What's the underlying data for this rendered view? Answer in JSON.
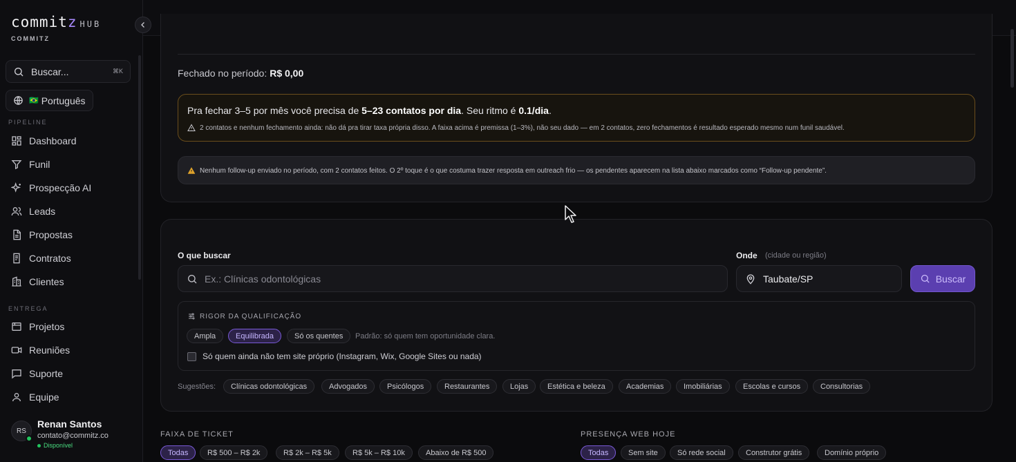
{
  "brand": {
    "logo_main": "commit",
    "logo_z": "z",
    "hub": "HUB",
    "sub": "COMMITZ"
  },
  "sidebar": {
    "search_label": "Buscar...",
    "search_shortcut": "⌘K",
    "language_flag": "🇧🇷",
    "language": "Português",
    "pipeline_label": "PIPELINE",
    "entrega_label": "ENTREGA",
    "pipeline_items": [
      {
        "label": "Dashboard",
        "icon": "grid-icon"
      },
      {
        "label": "Funil",
        "icon": "funnel-icon"
      },
      {
        "label": "Prospecção AI",
        "icon": "sparkles-icon"
      },
      {
        "label": "Leads",
        "icon": "users-icon"
      },
      {
        "label": "Propostas",
        "icon": "document-icon"
      },
      {
        "label": "Contratos",
        "icon": "contract-icon"
      },
      {
        "label": "Clientes",
        "icon": "building-icon"
      }
    ],
    "entrega_items": [
      {
        "label": "Projetos",
        "icon": "folder-icon"
      },
      {
        "label": "Reuniões",
        "icon": "video-icon"
      },
      {
        "label": "Suporte",
        "icon": "message-icon"
      },
      {
        "label": "Equipe",
        "icon": "user-icon"
      }
    ],
    "user": {
      "initials": "RS",
      "name": "Renan Santos",
      "email": "contato@commitz.co",
      "status": "Disponível"
    }
  },
  "topbar": {
    "icons": [
      "moon-icon",
      "bell-icon"
    ]
  },
  "summary": {
    "closed_label": "Fechado no período:",
    "closed_value": "R$ 0,00",
    "target_prefix": "Pra fechar 3–5 por mês você precisa de ",
    "target_bold": "5–23 contatos por dia",
    "target_mid": ". Seu ritmo é ",
    "target_rate": "0.1/dia",
    "target_end": ".",
    "target_note": "2 contatos e nenhum fechamento ainda: não dá pra tirar taxa própria disso. A faixa acima é premissa (1–3%), não seu dado — em 2 contatos, zero fechamentos é resultado esperado mesmo num funil saudável.",
    "followup_note": "Nenhum follow-up enviado no período, com 2 contatos feitos. O 2º toque é o que costuma trazer resposta em outreach frio — os pendentes aparecem na lista abaixo marcados como “Follow-up pendente”."
  },
  "search": {
    "what_label": "O que buscar",
    "what_placeholder": "Ex.: Clínicas odontológicas",
    "where_label": "Onde",
    "where_hint": "(cidade ou região)",
    "where_value": "Taubate/SP",
    "button": "Buscar",
    "rigor_title": "RIGOR DA QUALIFICAÇÃO",
    "rigor_options": [
      "Ampla",
      "Equilibrada",
      "Só os quentes"
    ],
    "rigor_selected": "Equilibrada",
    "rigor_hint": "Padrão: só quem tem oportunidade clara.",
    "no_site_label": "Só quem ainda não tem site próprio (Instagram, Wix, Google Sites ou nada)",
    "suggestions_label": "Sugestões:",
    "suggestions": [
      "Clínicas odontológicas",
      "Advogados",
      "Psicólogos",
      "Restaurantes",
      "Lojas",
      "Estética e beleza",
      "Academias",
      "Imobiliárias",
      "Escolas e cursos",
      "Consultorias"
    ]
  },
  "filters": {
    "ticket_title": "FAIXA DE TICKET",
    "ticket_options": [
      "Todas",
      "R$ 500 – R$ 2k",
      "R$ 2k – R$ 5k",
      "R$ 5k – R$ 10k",
      "Abaixo de R$ 500"
    ],
    "web_title": "PRESENÇA WEB HOJE",
    "web_options": [
      "Todas",
      "Sem site",
      "Só rede social",
      "Construtor grátis",
      "Domínio próprio"
    ]
  },
  "colors": {
    "accent": "#7a5ad8",
    "button": "#5b3fb0",
    "amber_border": "#6b4e1c",
    "status_green": "#22c55e"
  }
}
